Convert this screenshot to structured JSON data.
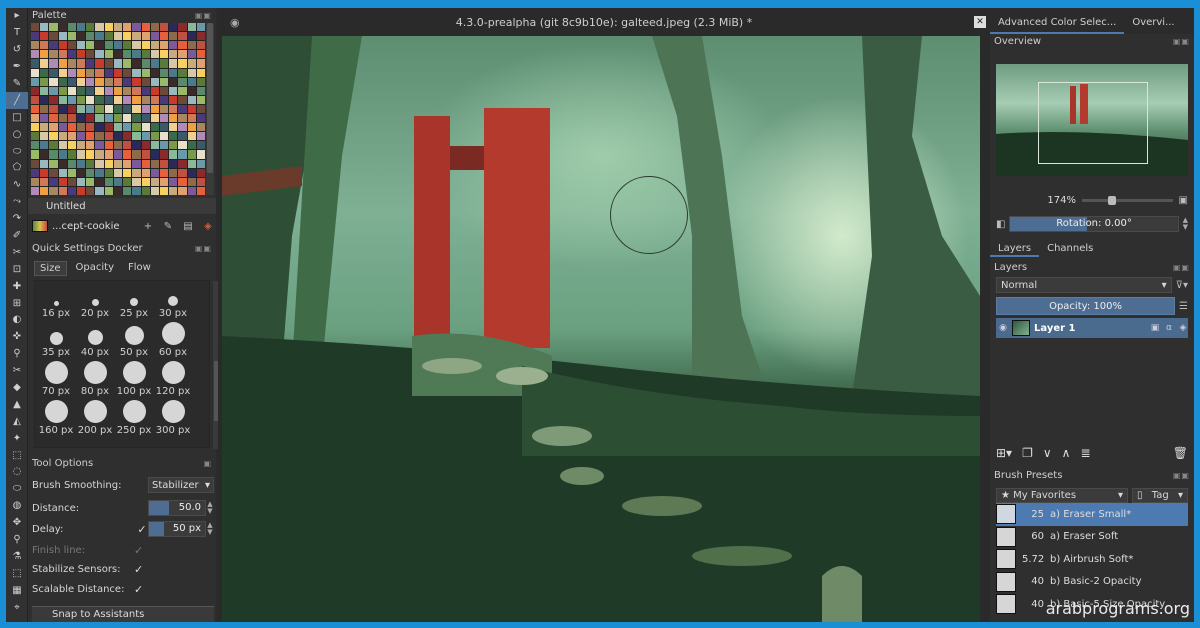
{
  "window": {
    "title": "4.3.0-prealpha (git 8c9b10e): galteed.jpeg (2.3 MiB) *"
  },
  "left_panel": {
    "palette_title": "Palette",
    "palette_name": "Untitled",
    "preset_name": "...cept-cookie",
    "quick_settings_title": "Quick Settings Docker",
    "tabs": [
      "Size",
      "Opacity",
      "Flow"
    ],
    "brush_sizes": [
      "16 px",
      "20 px",
      "25 px",
      "30 px",
      "35 px",
      "40 px",
      "50 px",
      "60 px",
      "70 px",
      "80 px",
      "100 px",
      "120 px",
      "160 px",
      "200 px",
      "250 px",
      "300 px"
    ],
    "tool_options_title": "Tool Options",
    "brush_smoothing_label": "Brush Smoothing:",
    "brush_smoothing_value": "Stabilizer",
    "distance_label": "Distance:",
    "distance_value": "50.0",
    "delay_label": "Delay:",
    "delay_value": "50 px",
    "finish_line_label": "Finish line:",
    "stabilize_label": "Stabilize Sensors:",
    "scalable_label": "Scalable Distance:",
    "snap_label": "Snap to Assistants"
  },
  "right_panel": {
    "tabs": [
      "Advanced Color Selec...",
      "Overvi..."
    ],
    "overview_title": "Overview",
    "zoom": "174%",
    "rotation": "Rotation: 0.00°",
    "layer_tabs": [
      "Layers",
      "Channels"
    ],
    "layers_title": "Layers",
    "blend_mode": "Normal",
    "opacity": "Opacity:  100%",
    "layer_name": "Layer 1",
    "brush_presets_title": "Brush Presets",
    "favorites": "★ My Favorites",
    "tag_label": "Tag",
    "presets": [
      {
        "size": "25",
        "name": "a) Eraser Small*"
      },
      {
        "size": "60",
        "name": "a) Eraser Soft"
      },
      {
        "size": "5.72",
        "name": "b) Airbrush Soft*"
      },
      {
        "size": "40",
        "name": "b) Basic-2 Opacity"
      },
      {
        "size": "40",
        "name": "b) Basic-5 Size Opacity"
      }
    ]
  },
  "watermark": "arabprograms.org",
  "colors": {
    "selection": "#4d7bb1",
    "panel": "#2f2f2f",
    "frame": "#1b8fd6"
  }
}
